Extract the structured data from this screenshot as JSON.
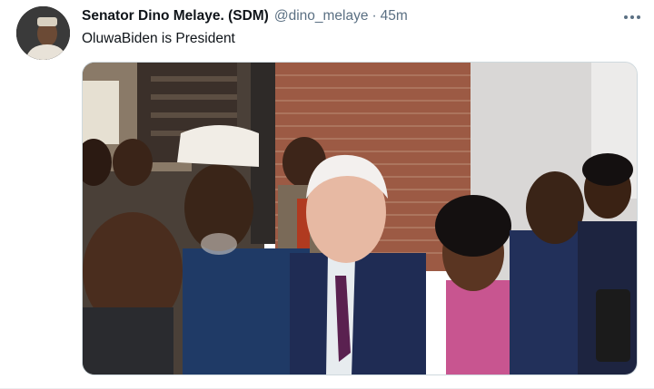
{
  "tweet": {
    "author_name": "Senator Dino Melaye. (SDM)",
    "handle": "@dino_melaye",
    "separator": "·",
    "time": "45m",
    "text": "OluwaBiden is President",
    "more_icon": "more-horizontal-icon"
  },
  "colors": {
    "text_primary": "#0f1419",
    "text_secondary": "#5b7083",
    "border": "#cfd9de"
  }
}
